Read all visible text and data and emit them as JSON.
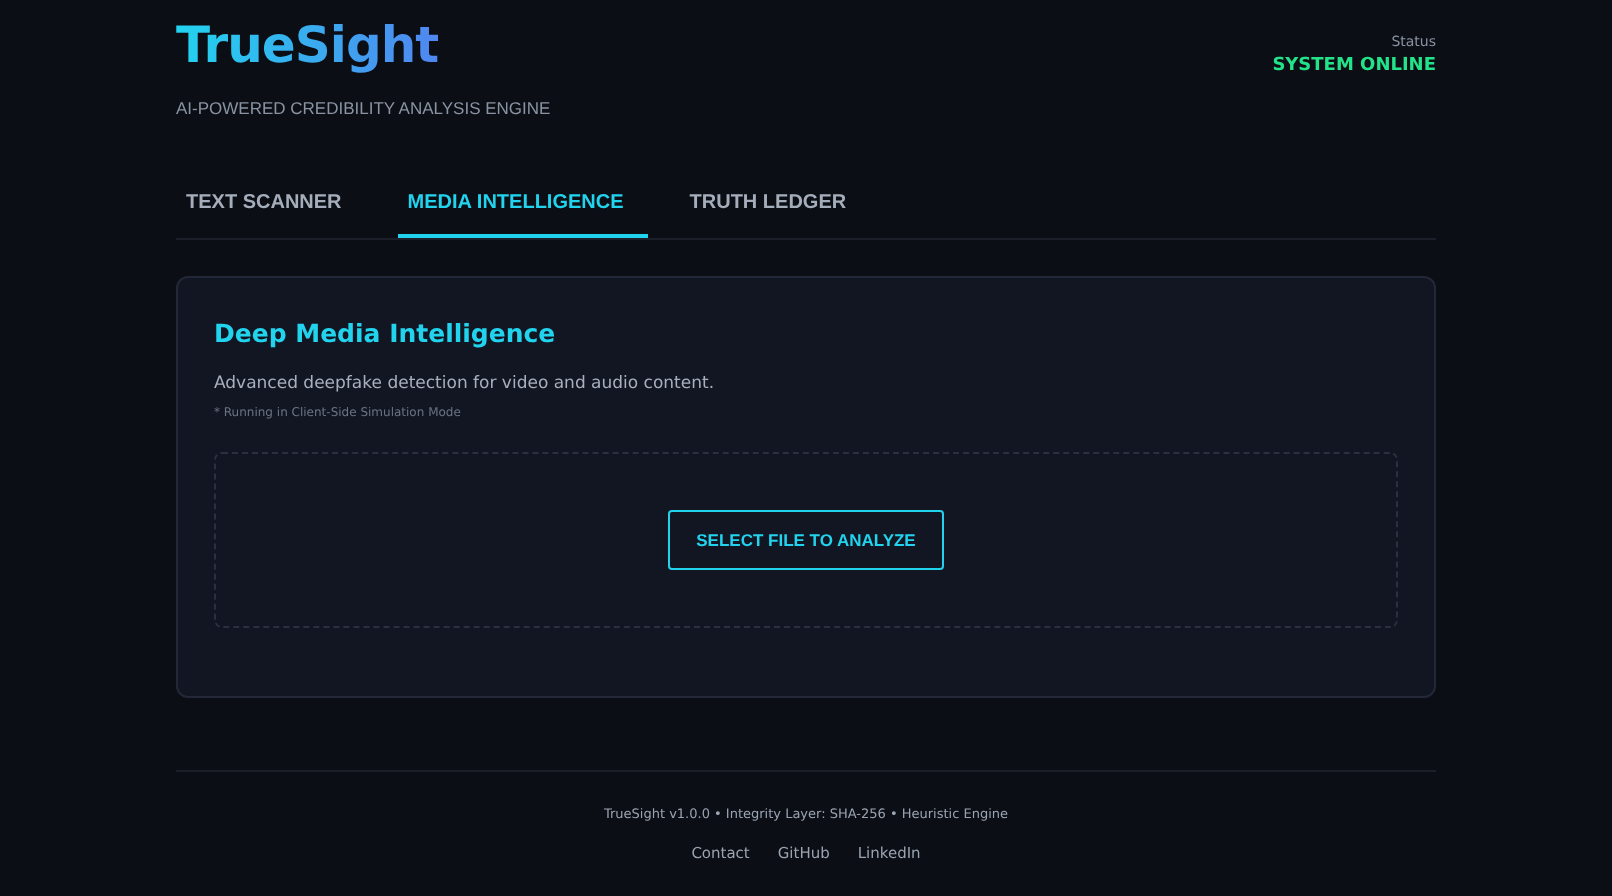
{
  "header": {
    "logo": "TrueSight",
    "tagline": "AI-POWERED CREDIBILITY ANALYSIS ENGINE",
    "status_label": "Status",
    "status_value": "SYSTEM ONLINE"
  },
  "tabs": [
    {
      "label": "TEXT SCANNER",
      "selected": false
    },
    {
      "label": "MEDIA INTELLIGENCE",
      "selected": true
    },
    {
      "label": "TRUTH LEDGER",
      "selected": false
    }
  ],
  "panel": {
    "title": "Deep Media Intelligence",
    "description": "Advanced deepfake detection for video and audio content.",
    "note": "* Running in Client-Side Simulation Mode",
    "button": "SELECT FILE TO ANALYZE"
  },
  "footer": {
    "info": "TrueSight v1.0.0 • Integrity Layer: SHA-256 • Heuristic Engine",
    "links": [
      "Contact",
      "GitHub",
      "LinkedIn"
    ]
  }
}
